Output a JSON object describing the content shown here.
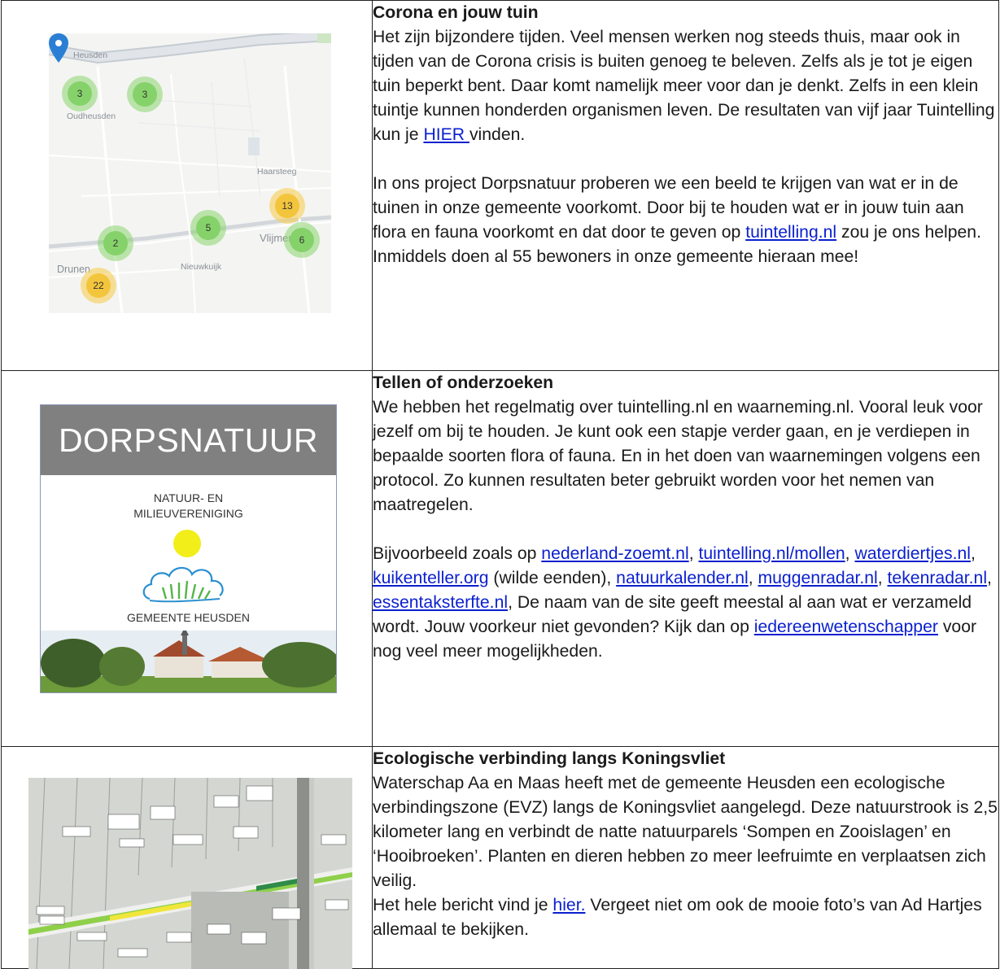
{
  "articles": [
    {
      "title": "Corona en jouw tuin",
      "p1_text": "Het zijn bijzondere tijden. Veel mensen werken nog steeds thuis, maar ook in tijden van de Corona crisis is buiten genoeg te beleven. Zelfs als je tot je eigen tuin beperkt bent. Daar komt namelijk meer voor dan je denkt. Zelfs in een klein tuintje kunnen honderden organismen leven. De resultaten van vijf jaar Tuintelling kun je ",
      "p1_link": "HIER ",
      "p1_end": " vinden.",
      "p2_text": "In ons project Dorpsnatuur proberen we een beeld te krijgen van wat er in de tuinen in onze gemeente voorkomt. Door bij te houden wat er in jouw tuin aan flora en fauna voorkomt en dat door te geven op  ",
      "p2_link": "tuintelling.nl",
      "p2_end": " zou je ons helpen. Inmiddels doen al 55 bewoners in onze gemeente hieraan mee!",
      "map": {
        "places": [
          "Heusden",
          "Oudheusden",
          "Haarsteeg",
          "Nieuwkuijk",
          "Vlijmen",
          "Drunen"
        ],
        "clusters": [
          "3",
          "3",
          "13",
          "5",
          "6",
          "2",
          "22"
        ]
      }
    },
    {
      "title": "Tellen of onderzoeken",
      "p1_text": "We hebben het regelmatig over tuintelling.nl en waarneming.nl. Vooral leuk voor jezelf om bij te houden. Je kunt ook een stapje verder gaan, en je verdiepen in bepaalde soorten flora of fauna. En in het doen van waarnemingen volgens een protocol. Zo kunnen resultaten beter gebruikt worden voor het nemen van maatregelen.",
      "p2_start": "Bijvoorbeeld zoals op ",
      "links": [
        "nederland-zoemt.nl",
        "tuintelling.nl/mollen",
        "waterdiertjes.nl",
        "kuikenteller.org",
        "natuurkalender.nl",
        "muggenradar.nl",
        "tekenradar.nl",
        "essentaksterfte.nl"
      ],
      "sep": ", ",
      "kuiken_note": " (wilde eenden), ",
      "p2_mid": ", De naam van de site geeft meestal al aan wat er verzameld wordt. Jouw voorkeur niet gevonden? Kijk dan op ",
      "p2_link2": "iedereenwetenschapper",
      "p2_end": " voor nog veel meer mogelijkheden.",
      "logo": {
        "title": "DORPSNATUUR",
        "line1": "NATUUR- EN",
        "line2": "MILIEUVERENIGING",
        "line3": "GEMEENTE HEUSDEN"
      }
    },
    {
      "title": "Ecologische verbinding langs Koningsvliet",
      "p1_text": "Waterschap Aa en Maas heeft met de gemeente Heusden een ecologische verbindingszone (EVZ) langs de Koningsvliet aangelegd. Deze natuurstrook is 2,5 kilometer lang en verbindt de natte natuurparels ‘Sompen en Zooislagen’ en ‘Hooibroeken’. Planten en dieren hebben zo meer leefruimte en verplaatsen zich veilig.",
      "p2_text": "Het hele bericht vind je ",
      "p2_link": "hier.",
      "p2_end": "  Vergeet niet om ook de mooie foto’s van Ad Hartjes allemaal te bekijken."
    }
  ],
  "colors": {
    "link": "#0a1fcf",
    "cluster_green": "#86d26a",
    "cluster_yellow": "#f3c53c",
    "pin": "#2a7fd4",
    "logo_band": "#808080",
    "sun": "#f2ee1a"
  }
}
